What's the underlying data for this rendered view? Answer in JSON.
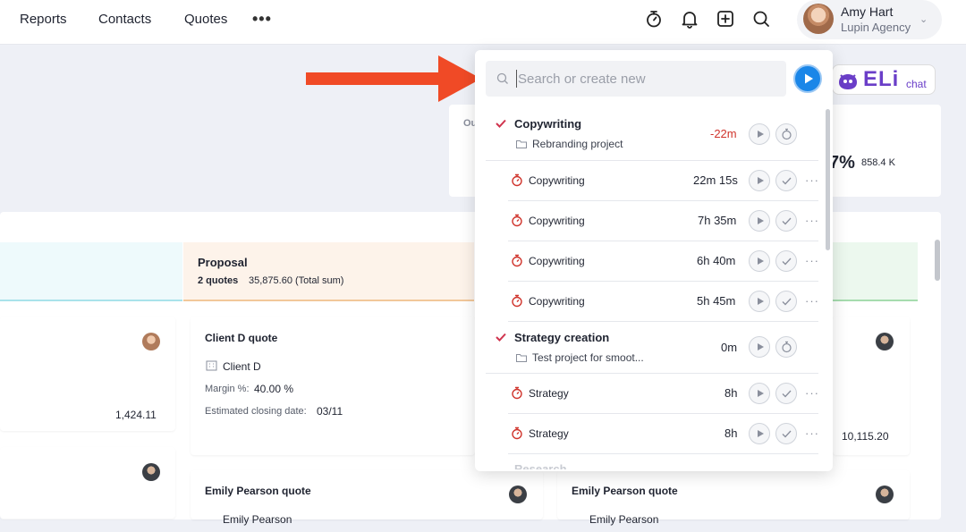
{
  "nav": {
    "items": [
      "Reports",
      "Contacts",
      "Quotes"
    ],
    "more": "•••"
  },
  "user": {
    "name": "Amy Hart",
    "org": "Lupin Agency"
  },
  "eli": {
    "logo": "ELi",
    "sub": "chat"
  },
  "board": {
    "stat_label": "Ou",
    "stat_pct": "7%",
    "stat_value": "858.4 K",
    "proposal": {
      "title": "Proposal",
      "count": "2 quotes",
      "sum": "35,875.60 (Total sum)"
    },
    "left_card_amount": "1,424.11",
    "card_client_d": {
      "title": "Client D quote",
      "client": "Client D",
      "margin_label": "Margin %:",
      "margin_value": "40.00 %",
      "closing_label": "Estimated closing date:",
      "closing_value": "03/11"
    },
    "right_card_amount": "10,115.20",
    "card_emily_1": {
      "title": "Emily Pearson quote",
      "client": "Emily Pearson"
    },
    "card_emily_2": {
      "title": "Emily Pearson quote",
      "client": "Emily Pearson"
    }
  },
  "search": {
    "placeholder": "Search or create new"
  },
  "tasks": [
    {
      "title": "Copywriting",
      "project": "Rebranding project",
      "time": "-22m",
      "entries": [
        {
          "label": "Copywriting",
          "time": "22m 15s"
        },
        {
          "label": "Copywriting",
          "time": "7h 35m"
        },
        {
          "label": "Copywriting",
          "time": "6h 40m"
        },
        {
          "label": "Copywriting",
          "time": "5h 45m"
        }
      ]
    },
    {
      "title": "Strategy creation",
      "project": "Test project for smoot...",
      "time": "0m",
      "entries": [
        {
          "label": "Strategy",
          "time": "8h"
        },
        {
          "label": "Strategy",
          "time": "8h"
        }
      ]
    },
    {
      "title": "Research"
    }
  ],
  "colors": {
    "accent": "#1a86e8",
    "overdue": "#d0342c",
    "check": "#d0344e",
    "arrow": "#f04a26",
    "eli": "#6a3ec8"
  }
}
